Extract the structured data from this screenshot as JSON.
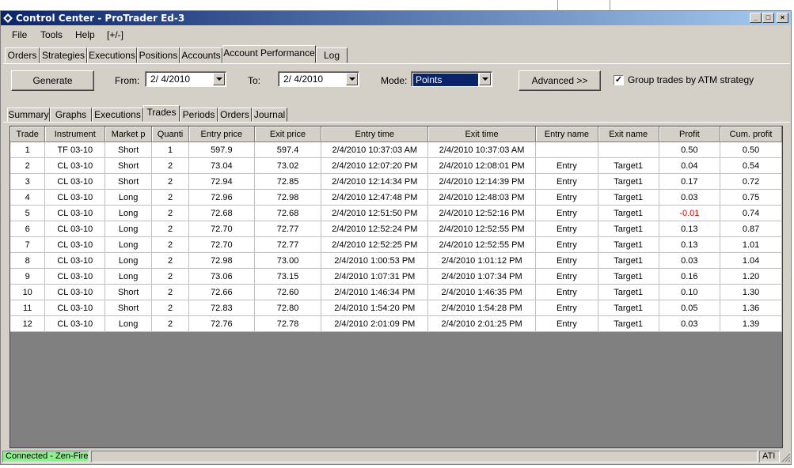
{
  "window": {
    "title": "Control Center - ProTrader Ed-3"
  },
  "menu": {
    "items": [
      "File",
      "Tools",
      "Help",
      "[+/-]"
    ]
  },
  "main_tabs": [
    "Orders",
    "Strategies",
    "Executions",
    "Positions",
    "Accounts",
    "Account Performance",
    "Log"
  ],
  "main_tabs_active": "Account Performance",
  "toolbar": {
    "generate_label": "Generate",
    "from_label": "From:",
    "from_value": "2/ 4/2010",
    "to_label": "To:",
    "to_value": "2/ 4/2010",
    "mode_label": "Mode:",
    "mode_value": "Points",
    "advanced_label": "Advanced >>",
    "group_label": "Group trades by ATM strategy",
    "group_checked": true
  },
  "sub_tabs": [
    "Summary",
    "Graphs",
    "Executions",
    "Trades",
    "Periods",
    "Orders",
    "Journal"
  ],
  "sub_tabs_active": "Trades",
  "table": {
    "columns": [
      "Trade",
      "Instrument",
      "Market p",
      "Quanti",
      "Entry price",
      "Exit price",
      "Entry time",
      "Exit time",
      "Entry name",
      "Exit name",
      "Profit",
      "Cum. profit"
    ],
    "rows": [
      [
        "1",
        "TF 03-10",
        "Short",
        "1",
        "597.9",
        "597.4",
        "2/4/2010 10:37:03 AM",
        "2/4/2010 10:37:03 AM",
        "",
        "",
        "0.50",
        "0.50"
      ],
      [
        "2",
        "CL 03-10",
        "Short",
        "2",
        "73.04",
        "73.02",
        "2/4/2010 12:07:20 PM",
        "2/4/2010 12:08:01 PM",
        "Entry",
        "Target1",
        "0.04",
        "0.54"
      ],
      [
        "3",
        "CL 03-10",
        "Short",
        "2",
        "72.94",
        "72.85",
        "2/4/2010 12:14:34 PM",
        "2/4/2010 12:14:39 PM",
        "Entry",
        "Target1",
        "0.17",
        "0.72"
      ],
      [
        "4",
        "CL 03-10",
        "Long",
        "2",
        "72.96",
        "72.98",
        "2/4/2010 12:47:48 PM",
        "2/4/2010 12:48:03 PM",
        "Entry",
        "Target1",
        "0.03",
        "0.75"
      ],
      [
        "5",
        "CL 03-10",
        "Long",
        "2",
        "72.68",
        "72.68",
        "2/4/2010 12:51:50 PM",
        "2/4/2010 12:52:16 PM",
        "Entry",
        "Target1",
        "-0.01",
        "0.74"
      ],
      [
        "6",
        "CL 03-10",
        "Long",
        "2",
        "72.70",
        "72.77",
        "2/4/2010 12:52:24 PM",
        "2/4/2010 12:52:55 PM",
        "Entry",
        "Target1",
        "0.13",
        "0.87"
      ],
      [
        "7",
        "CL 03-10",
        "Long",
        "2",
        "72.70",
        "72.77",
        "2/4/2010 12:52:25 PM",
        "2/4/2010 12:52:55 PM",
        "Entry",
        "Target1",
        "0.13",
        "1.01"
      ],
      [
        "8",
        "CL 03-10",
        "Long",
        "2",
        "72.98",
        "73.00",
        "2/4/2010 1:00:53 PM",
        "2/4/2010 1:01:12 PM",
        "Entry",
        "Target1",
        "0.03",
        "1.04"
      ],
      [
        "9",
        "CL 03-10",
        "Long",
        "2",
        "73.06",
        "73.15",
        "2/4/2010 1:07:31 PM",
        "2/4/2010 1:07:34 PM",
        "Entry",
        "Target1",
        "0.16",
        "1.20"
      ],
      [
        "10",
        "CL 03-10",
        "Short",
        "2",
        "72.66",
        "72.60",
        "2/4/2010 1:46:34 PM",
        "2/4/2010 1:46:35 PM",
        "Entry",
        "Target1",
        "0.10",
        "1.30"
      ],
      [
        "11",
        "CL 03-10",
        "Short",
        "2",
        "72.83",
        "72.80",
        "2/4/2010 1:54:20 PM",
        "2/4/2010 1:54:28 PM",
        "Entry",
        "Target1",
        "0.05",
        "1.36"
      ],
      [
        "12",
        "CL 03-10",
        "Long",
        "2",
        "72.76",
        "72.78",
        "2/4/2010 2:01:09 PM",
        "2/4/2010 2:01:25 PM",
        "Entry",
        "Target1",
        "0.03",
        "1.39"
      ]
    ]
  },
  "status": {
    "connection": "Connected - Zen-Fire",
    "right": "ATI"
  },
  "colors": {
    "title_start": "#0a246a",
    "title_end": "#a6caf0",
    "connected_bg": "#90ee90",
    "negative": "#cc0000",
    "grid_empty": "#808080"
  }
}
